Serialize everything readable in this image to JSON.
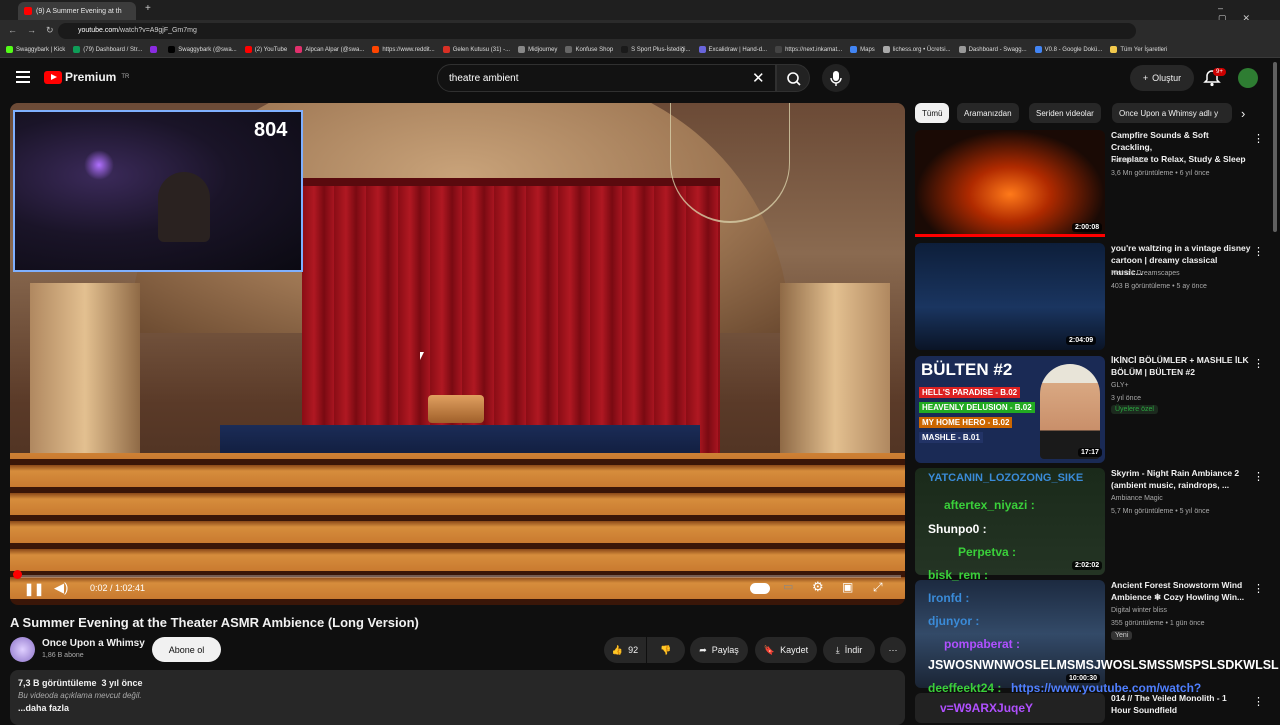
{
  "browser": {
    "tab_title": "(9) A Summer Evening at th",
    "url_domain": "youtube.com",
    "url_path": "/watch?v=A9gjF_Gm7mg",
    "bookmarks": [
      "Swaggybark | Kick",
      "(79) Dashboard / Str...",
      "",
      "Swaggybark (@swa...",
      "(2) YouTube",
      "Alpcan Alpar (@swa...",
      "https://www.reddit...",
      "Gelen Kutusu (31) -...",
      "Midjourney",
      "Konfuse Shop",
      "S Sport Plus-İstediği...",
      "Excalidraw | Hand-d...",
      "https://next.inkamat...",
      "Maps",
      "lichess.org • Ücretsi...",
      "Dashboard - Swagg...",
      "V0.8 - Google Dokü...",
      "Tüm Yer İşaretleri"
    ]
  },
  "header": {
    "logo": "Premium",
    "region": "TR",
    "search_value": "theatre ambient",
    "create_label": "Oluştur",
    "notif_count": "9+"
  },
  "player": {
    "cam_count": "804",
    "time": "0:02 / 1:02:41",
    "progress": 0.0005
  },
  "video": {
    "title": "A Summer Evening at the Theater ASMR Ambience (Long Version)",
    "channel": "Once Upon a Whimsy",
    "subs": "1,86 B abone",
    "subscribe": "Abone ol",
    "likes": "92",
    "share": "Paylaş",
    "save": "Kaydet",
    "download": "İndir",
    "views": "7,3 B görüntüleme",
    "age": "3 yıl önce",
    "no_desc": "Bu videoda açıklama mevcut değil.",
    "more": "...daha fazla"
  },
  "chips": [
    "Tümü",
    "Aramanızdan",
    "Seriden videolar",
    "Once Upon a Whimsy adlı y"
  ],
  "recs": [
    {
      "title1": "Campfire Sounds & Soft Crackling,",
      "title2": "Fireplace to Relax, Study & Sleep",
      "channel": "Nature SFX",
      "meta": "3,6 Mn görüntüleme • 6 yıl önce",
      "duration": "2:00:08"
    },
    {
      "title1": "you're waltzing in a vintage disney",
      "title2": "cartoon | dreamy classical music...",
      "channel": "Nemo's Dreamscapes",
      "meta": "403 B görüntüleme • 5 ay önce",
      "duration": "2:04:09"
    },
    {
      "title1": "İKİNCİ BÖLÜMLER + MASHLE İLK",
      "title2": "BÖLÜM | BÜLTEN #2",
      "channel": "GLY+",
      "meta": "3 yıl önce",
      "members": "Üyelere özel",
      "duration": "17:17",
      "thumb_title": "BÜLTEN #2",
      "thumb_lines": [
        "HELL'S PARADISE - B.02",
        "HEAVENLY DELUSION - B.02",
        "MY HOME HERO - B.02",
        "MASHLE - B.01"
      ]
    },
    {
      "title1": "Skyrim - Night Rain Ambiance 2",
      "title2": "(ambient music, raindrops, ...",
      "channel": "Ambiance Magic",
      "meta": "5,7 Mn görüntüleme • 5 yıl önce",
      "duration": "2:02:02"
    },
    {
      "title1": "Ancient Forest Snowstorm Wind",
      "title2": "Ambience ❄ Cozy Howling Win...",
      "channel": "Digital winter bliss",
      "meta": "355 görüntüleme • 1 gün önce",
      "badge": "Yeni",
      "duration": "10:00:30"
    },
    {
      "title1": "014 // The Veiled Monolith - 1",
      "title2": "Hour Soundfield",
      "channel": "",
      "meta": "",
      "duration": ""
    }
  ],
  "chat": [
    "YATCANIN_LOZOZONG_SIKE",
    "aftertex_niyazi :",
    "Shunpo0 :",
    "Perpetva :",
    "bisk_rem :",
    "Ironfd :",
    "djunyor :",
    "pompaberat :",
    "JSWOSNWNWOSLELMSMSJWOSLSMSSMSPSLSDKWLSL",
    "deeffeekt24 :",
    "https://www.youtube.com/watch?",
    "v=W9ARXJuqeY"
  ]
}
